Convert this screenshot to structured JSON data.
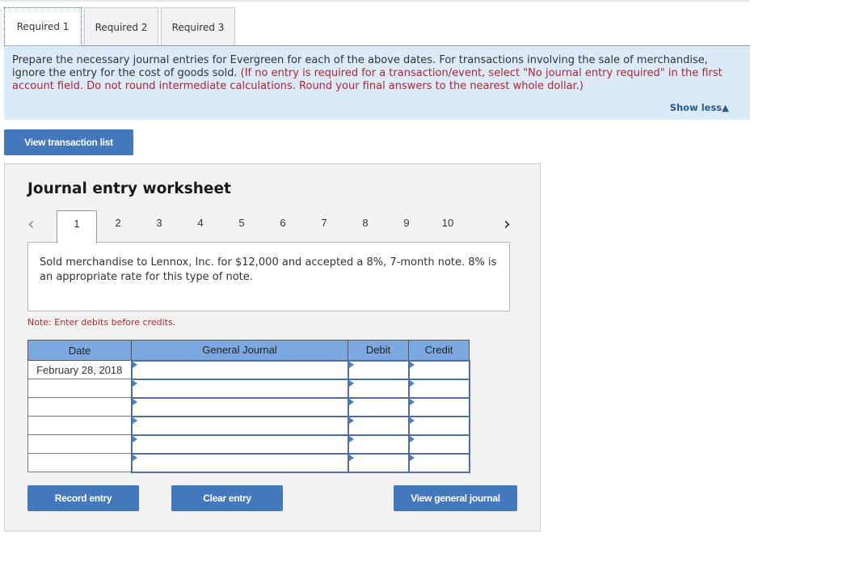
{
  "tabs": [
    {
      "label": "Required 1",
      "active": true
    },
    {
      "label": "Required 2",
      "active": false
    },
    {
      "label": "Required 3",
      "active": false
    }
  ],
  "instructions": {
    "text_plain": "Prepare the necessary journal entries for Evergreen for each of the above dates. For transactions involving the sale of merchandise, ignore the entry for the cost of goods sold.",
    "text_red": "(If no entry is required for a transaction/event, select \"No journal entry required\" in the first account field. Do not round intermediate calculations. Round your final answers to the nearest whole dollar.)",
    "toggle_label": "Show less",
    "toggle_icon": "triangle-up-icon"
  },
  "buttons": {
    "view_transaction_list": "View transaction list",
    "record_entry": "Record entry",
    "clear_entry": "Clear entry",
    "view_general_journal": "View general journal"
  },
  "worksheet": {
    "title": "Journal entry worksheet",
    "pager": {
      "prev_icon": "chevron-left-icon",
      "next_icon": "chevron-right-icon",
      "pages": [
        "1",
        "2",
        "3",
        "4",
        "5",
        "6",
        "7",
        "8",
        "9",
        "10"
      ],
      "active_page": "1"
    },
    "description": "Sold merchandise to Lennox, Inc. for $12,000 and accepted a 8%, 7-month note. 8% is an appropriate rate for this type of note.",
    "note": "Note: Enter debits before credits.",
    "table": {
      "headers": [
        "Date",
        "General Journal",
        "Debit",
        "Credit"
      ],
      "rows": [
        {
          "date": "February 28, 2018",
          "account": "",
          "debit": "",
          "credit": ""
        },
        {
          "date": "",
          "account": "",
          "debit": "",
          "credit": ""
        },
        {
          "date": "",
          "account": "",
          "debit": "",
          "credit": ""
        },
        {
          "date": "",
          "account": "",
          "debit": "",
          "credit": ""
        },
        {
          "date": "",
          "account": "",
          "debit": "",
          "credit": ""
        },
        {
          "date": "",
          "account": "",
          "debit": "",
          "credit": ""
        }
      ]
    }
  },
  "colors": {
    "accent_button": "#4478bd",
    "instruction_bg": "#dbeaf8",
    "warning_red": "#b0262b",
    "table_header": "#7ba9df"
  }
}
